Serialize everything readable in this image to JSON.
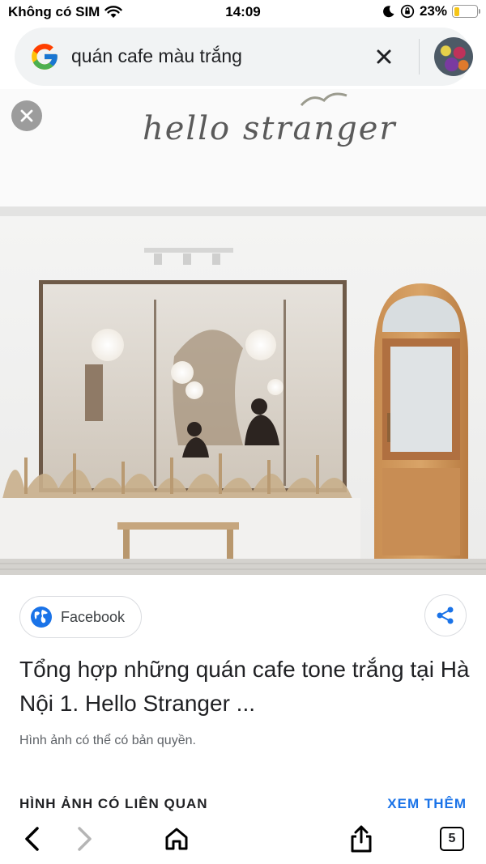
{
  "status_bar": {
    "carrier": "Không có SIM",
    "time": "14:09",
    "battery_percent": "23%",
    "battery_level": 0.23
  },
  "search": {
    "query": "quán cafe màu trắng"
  },
  "image": {
    "sign_text": "hello stranger"
  },
  "result": {
    "source": "Facebook",
    "title": "Tổng hợp những quán cafe tone trắng tại Hà Nội 1. Hello Stranger ...",
    "copyright_note": "Hình ảnh có thể có bản quyền."
  },
  "related": {
    "heading": "HÌNH ẢNH CÓ LIÊN QUAN",
    "see_more": "XEM THÊM"
  },
  "toolbar": {
    "tabs_count": "5"
  },
  "colors": {
    "accent": "#1a73e8",
    "battery": "#f5c518"
  }
}
